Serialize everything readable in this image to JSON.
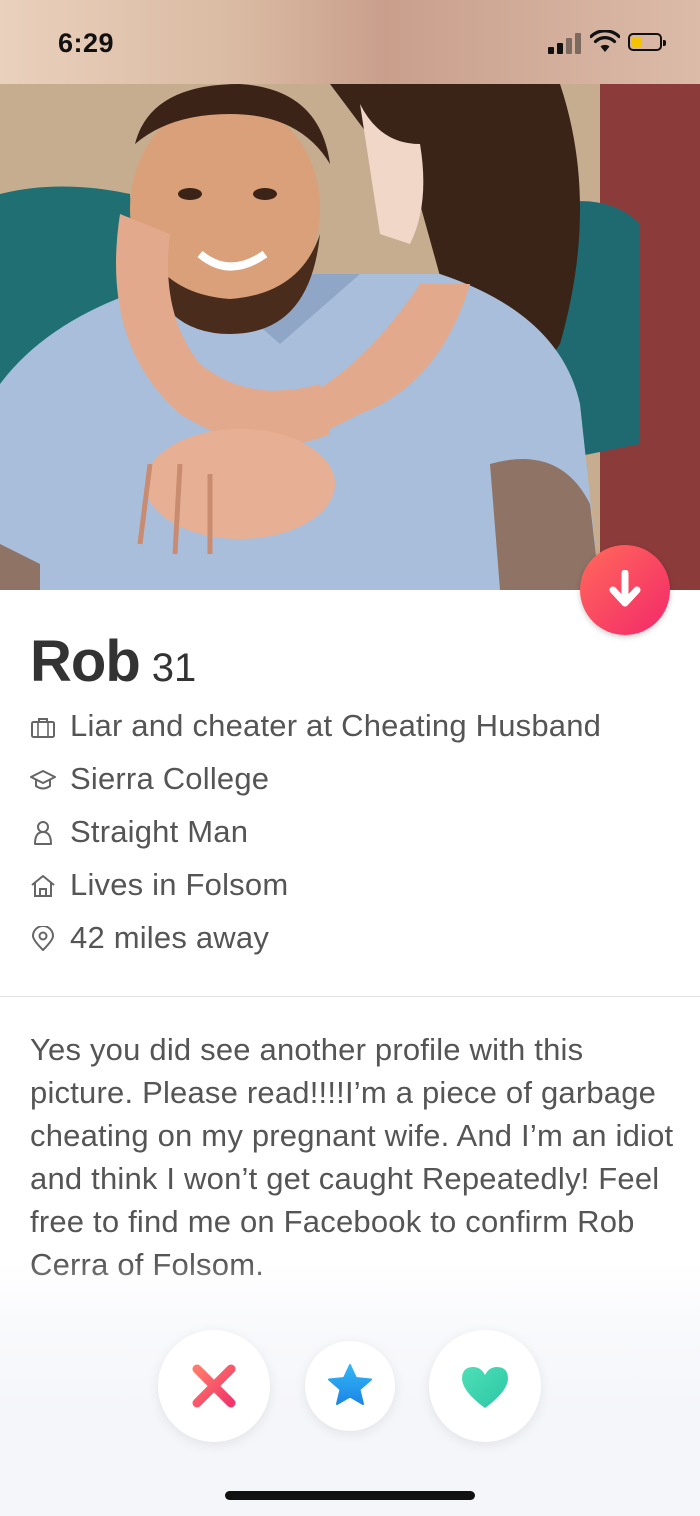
{
  "status_bar": {
    "time": "6:29",
    "icons": [
      "signal-icon",
      "wifi-icon",
      "battery-icon"
    ],
    "battery_color": "#f5c400"
  },
  "photo": {
    "description_icon": "profile-photo"
  },
  "profile": {
    "name": "Rob",
    "age": "31",
    "details": [
      {
        "icon": "briefcase-icon",
        "text": "Liar and cheater at Cheating Husband"
      },
      {
        "icon": "graduation-cap-icon",
        "text": "Sierra College"
      },
      {
        "icon": "person-icon",
        "text": "Straight Man"
      },
      {
        "icon": "home-icon",
        "text": "Lives in Folsom"
      },
      {
        "icon": "location-pin-icon",
        "text": "42 miles away"
      }
    ],
    "bio": "Yes you did see another profile with this picture. Please read!!!!I’m a piece of garbage cheating on my pregnant wife. And I’m an idiot and think I won’t get caught Repeatedly! Feel free to find me on Facebook to confirm Rob Cerra of Folsom."
  },
  "actions": {
    "nope_icon": "close-icon",
    "superlike_icon": "star-icon",
    "like_icon": "heart-icon"
  },
  "colors": {
    "accent_gradient_start": "#ff6a5a",
    "accent_gradient_end": "#f3286a",
    "nope": "#f2454f",
    "superlike": "#1f9bf0",
    "like": "#3ad5b0"
  }
}
